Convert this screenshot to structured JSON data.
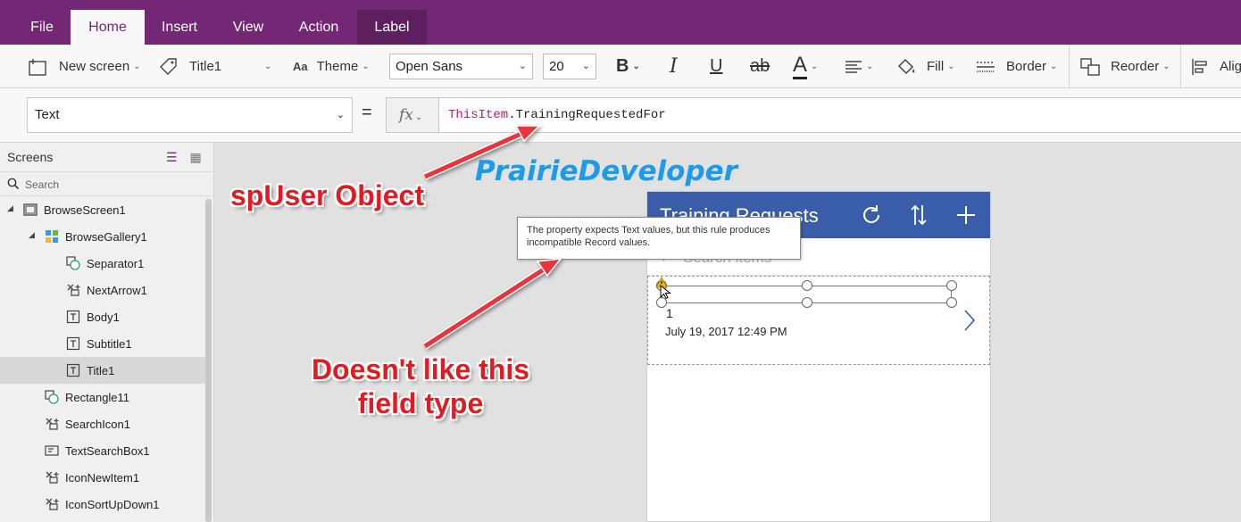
{
  "menu": {
    "tabs": [
      {
        "label": "File"
      },
      {
        "label": "Home"
      },
      {
        "label": "Insert"
      },
      {
        "label": "View"
      },
      {
        "label": "Action"
      },
      {
        "label": "Label"
      }
    ]
  },
  "ribbon": {
    "new_screen": "New screen",
    "control_name": "Title1",
    "theme": "Theme",
    "font": "Open Sans",
    "font_size": "20",
    "bold": "B",
    "italic": "I",
    "underline": "U",
    "strike": "ab",
    "font_color": "A",
    "fill": "Fill",
    "border": "Border",
    "reorder": "Reorder",
    "align": "Alig"
  },
  "formula_bar": {
    "property": "Text",
    "equals": "=",
    "fx": "fx",
    "formula_keyword": "ThisItem",
    "formula_rest": ".TrainingRequestedFor"
  },
  "tree": {
    "title": "Screens",
    "search_placeholder": "Search",
    "items": [
      {
        "label": "BrowseScreen1"
      },
      {
        "label": "BrowseGallery1"
      },
      {
        "label": "Separator1"
      },
      {
        "label": "NextArrow1"
      },
      {
        "label": "Body1"
      },
      {
        "label": "Subtitle1"
      },
      {
        "label": "Title1"
      },
      {
        "label": "Rectangle11"
      },
      {
        "label": "SearchIcon1"
      },
      {
        "label": "TextSearchBox1"
      },
      {
        "label": "IconNewItem1"
      },
      {
        "label": "IconSortUpDown1"
      }
    ]
  },
  "app_screen": {
    "title": "Training Requests",
    "search_placeholder": "Search items",
    "item_value": "1",
    "item_date": "July 19, 2017 12:49 PM"
  },
  "tooltip": {
    "text": "The property expects Text values, but this rule produces incompatible Record values."
  },
  "annotations": {
    "watermark": "PrairieDeveloper",
    "callout_1": "spUser Object",
    "callout_2_line1": "Doesn't like this",
    "callout_2_line2": "field type"
  },
  "colors": {
    "menu_bg": "#742774",
    "app_header": "#3a5daa",
    "formula_keyword": "#c0196e",
    "annotation_red": "#e11b22",
    "watermark_blue": "#1e9be8"
  }
}
